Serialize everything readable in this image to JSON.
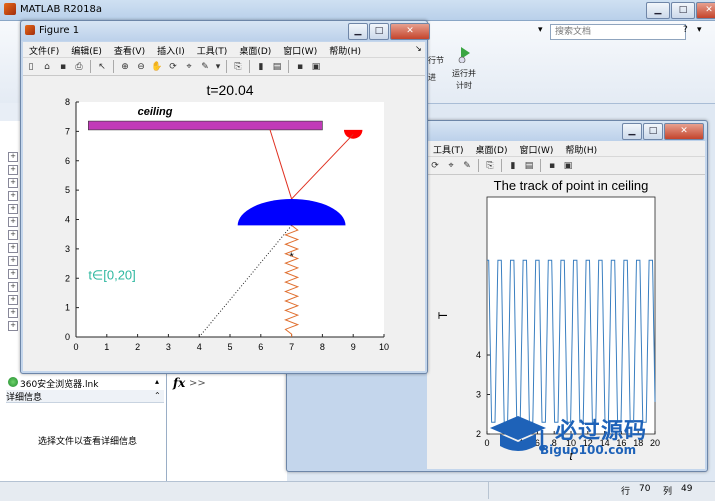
{
  "main_window": {
    "title": "MATLAB R2018a",
    "search_placeholder": "搜索文档",
    "ribbon_buttons": [
      "行节",
      "运行并\n计时"
    ],
    "ribbon_button_1": "行节",
    "ribbon_button_2a": "运行并",
    "ribbon_button_2b": "计时",
    "ribbon_button_3": "进"
  },
  "file_browser": {
    "file_item": "360安全浏览器.lnk",
    "details_header": "详细信息",
    "details_text": "选择文件以查看详细信息"
  },
  "command_window": {
    "prompt": "fx",
    "chevrons": ">>"
  },
  "status_bar": {
    "row_label": "行",
    "row_value": "70",
    "col_label": "列",
    "col_value": "49"
  },
  "figure1": {
    "title": "Figure 1",
    "menu": [
      "文件(F)",
      "编辑(E)",
      "查看(V)",
      "插入(I)",
      "工具(T)",
      "桌面(D)",
      "窗口(W)",
      "帮助(H)"
    ]
  },
  "figure2": {
    "menu": [
      "工具(T)",
      "桌面(D)",
      "窗口(W)",
      "帮助(H)"
    ]
  },
  "watermark": {
    "cn": "必过源码",
    "en": "Biguo100.com"
  },
  "chart_data": [
    {
      "type": "line",
      "title": "t=20.04",
      "xlim": [
        0,
        10
      ],
      "ylim": [
        0,
        8
      ],
      "xticks": [
        0,
        1,
        2,
        3,
        4,
        5,
        6,
        7,
        8,
        9,
        10
      ],
      "yticks": [
        0,
        1,
        2,
        3,
        4,
        5,
        6,
        7,
        8
      ],
      "grid": false,
      "annotations": {
        "ceiling_label": "ceiling",
        "interval_label": "t∈[0,20]"
      },
      "ceiling_bar": {
        "x": [
          0.4,
          8.0
        ],
        "y": [
          7.05,
          7.35
        ],
        "color": "#c13ab8"
      },
      "red_semicircle": {
        "center": [
          9.0,
          7.05
        ],
        "radius": 0.3,
        "color": "#ff0000"
      },
      "blue_dome": {
        "center": [
          7.0,
          3.8
        ],
        "radius": 1.75,
        "color": "#0000ff"
      },
      "rod_1": {
        "x": [
          6.3,
          7.0
        ],
        "y": [
          7.05,
          4.7
        ],
        "color": "#e03020"
      },
      "rod_2": {
        "x": [
          7.0,
          9.0
        ],
        "y": [
          4.7,
          6.9
        ],
        "color": "#e03020"
      },
      "spring": {
        "x_center": 7.0,
        "y_top": 3.8,
        "y_bottom": 0.1,
        "amplitude": 0.2,
        "coils": 11,
        "color": "#e07030"
      },
      "marker": {
        "x": 7.0,
        "y": 2.75,
        "symbol": "*"
      },
      "dotted_line": {
        "x": [
          4.0,
          7.0
        ],
        "y": [
          0.0,
          3.8
        ]
      },
      "colors": {
        "text_teal": "#2fb8a0",
        "axes_bg": "#ffffff"
      }
    },
    {
      "type": "line",
      "title": "The track of point in ceiling",
      "xlabel": "t",
      "ylabel": "T",
      "xlim": [
        0,
        20
      ],
      "ylim": [
        2,
        8
      ],
      "xticks": [
        0,
        2,
        4,
        6,
        8,
        10,
        12,
        14,
        16,
        18,
        20
      ],
      "yticks": [
        2,
        3,
        4
      ],
      "series": [
        {
          "period": 1.5,
          "high": 6.4,
          "low": 2.3,
          "color": "#3a7fc0"
        }
      ]
    }
  ]
}
